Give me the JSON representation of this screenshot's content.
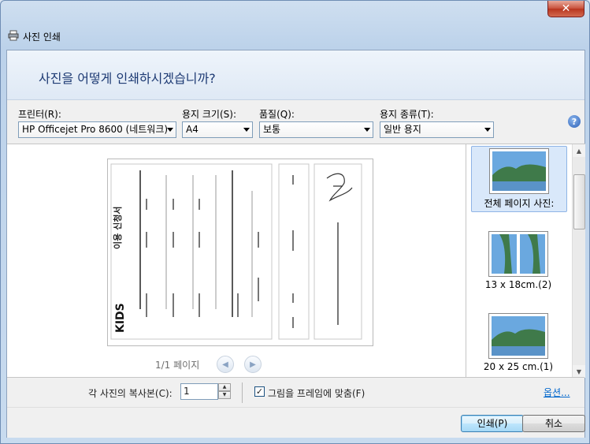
{
  "window": {
    "title": "사진 인쇄",
    "close_glyph": "✕"
  },
  "header": {
    "question": "사진을 어떻게 인쇄하시겠습니까?"
  },
  "printer": {
    "label": "프린터(R):",
    "value": "HP Officejet Pro 8600 (네트워크)"
  },
  "paper_size": {
    "label": "용지 크기(S):",
    "value": "A4"
  },
  "quality": {
    "label": "품질(Q):",
    "value": "보통"
  },
  "paper_type": {
    "label": "용지 종류(T):",
    "value": "일반 용지"
  },
  "help_glyph": "?",
  "preview": {
    "page_indicator": "1/1 페이지",
    "form_title": "이용 신청서",
    "brand": "KIDS",
    "prev_glyph": "◀",
    "next_glyph": "▶"
  },
  "layouts": [
    {
      "caption": "전체 페이지 사진:",
      "selected": true
    },
    {
      "caption": "13 x 18cm.(2)",
      "selected": false
    },
    {
      "caption": "20 x 25 cm.(1)",
      "selected": false
    }
  ],
  "copies": {
    "label": "각 사진의 복사본(C):",
    "value": "1"
  },
  "fit": {
    "label": "그림을 프레임에 맞춤(F)",
    "checked": true,
    "check_glyph": "✓"
  },
  "options_link": "옵션...",
  "buttons": {
    "print": "인쇄(P)",
    "cancel": "취소"
  },
  "colors": {
    "header_text": "#1d3a73",
    "link": "#0066cc",
    "selection": "#d9e8fa"
  }
}
